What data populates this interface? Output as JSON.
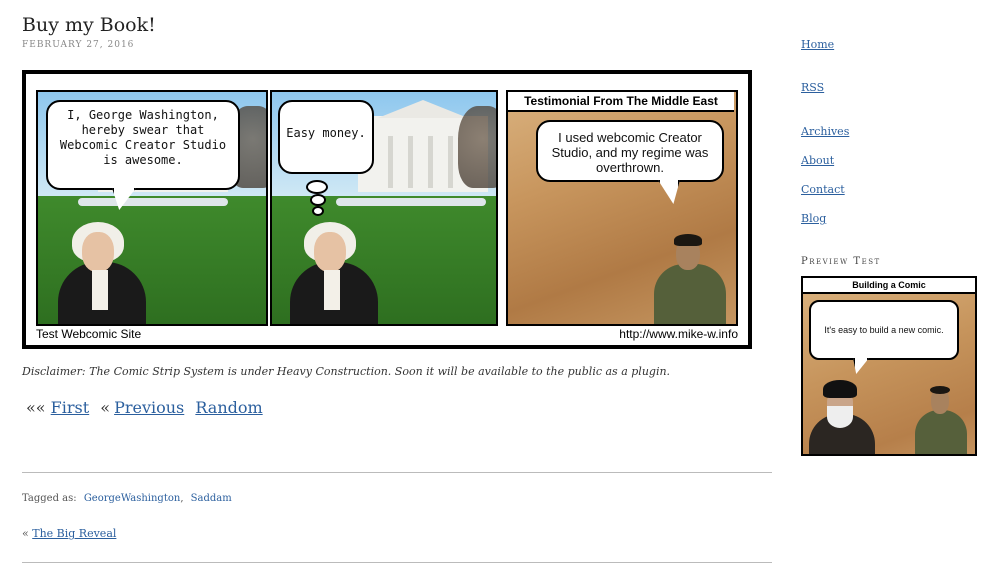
{
  "post": {
    "title": "Buy my Book!",
    "date": "February 27, 2016"
  },
  "comic": {
    "panel1_bubble": "I, George Washington, hereby swear that Webcomic Creator Studio is awesome.",
    "panel2_bubble": "Easy money.",
    "panel3_title": "Testimonial From The Middle East",
    "panel3_bubble": "I used webcomic Creator Studio, and my regime was overthrown.",
    "footer_left": "Test Webcomic Site",
    "footer_right": "http://www.mike-w.info"
  },
  "disclaimer": "Disclaimer: The Comic Strip System is under Heavy Construction. Soon it will be available to the public as a plugin.",
  "comic_nav": {
    "first_prefix": "««",
    "first": "First",
    "prev_prefix": "«",
    "previous": "Previous",
    "random": "Random"
  },
  "tags": {
    "label": "Tagged as:",
    "items": [
      "GeorgeWashington",
      "Saddam"
    ]
  },
  "prev_post": {
    "prefix": "«",
    "title": "The Big Reveal"
  },
  "sidebar": {
    "links": [
      "Home",
      "RSS",
      "Archives",
      "About",
      "Contact",
      "Blog"
    ],
    "preview_heading": "Preview Test",
    "preview_title": "Building a Comic",
    "preview_bubble": "It's easy to build a new comic."
  }
}
